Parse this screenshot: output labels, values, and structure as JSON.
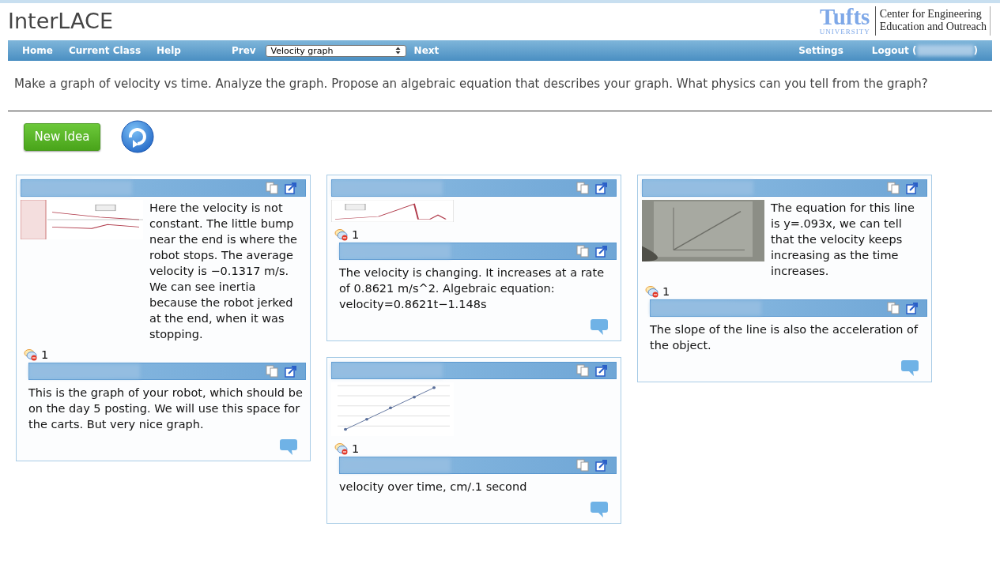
{
  "header": {
    "app_title": "InterLACE",
    "logo": {
      "wordmark": "Tufts",
      "sub": "UNIVERSITY",
      "lines": [
        "Center for Engineering",
        "Education and Outreach"
      ]
    }
  },
  "nav": {
    "left": [
      "Home",
      "Current Class",
      "Help"
    ],
    "prev": "Prev",
    "select_value": "Velocity graph",
    "next": "Next",
    "settings": "Settings",
    "logout_open": "Logout (",
    "logout_close": ")"
  },
  "prompt": "Make a graph of velocity vs time.  Analyze the graph. Propose an algebraic equation that describes your graph.  What physics can you tell from the graph?",
  "new_idea": "New Idea",
  "columns": [
    [
      {
        "image": {
          "kind": "picture"
        },
        "text": "Here the velocity is not constant. The little bump near the end is where the robot stops. The average velocity is −0.1317 m/s. We can see inertia because the robot jerked at the end, when it was stopping.",
        "reply_count": "1",
        "replies": [
          {
            "text": "This is the graph of your robot, which should be on the day 5 posting. We will use this space for the carts. But very nice graph."
          }
        ]
      }
    ],
    [
      {
        "image": {
          "kind": "picture"
        },
        "reply_count": "1",
        "replies": [
          {
            "text": "The velocity is changing. It increases at a rate of 0.8621 m/s^2. Algebraic equation: velocity=0.8621t−1.148s"
          }
        ]
      },
      {
        "image": {
          "kind": "picture"
        },
        "reply_count": "1",
        "replies": [
          {
            "text": "velocity over time, cm/.1 second"
          }
        ]
      }
    ],
    [
      {
        "image": {
          "kind": "picture"
        },
        "text": "The equation for this line is y=.093x, we can tell that the velocity keeps increasing as the time increases.",
        "reply_count": "1",
        "replies": [
          {
            "text": "The slope of the line is also the acceleration of the object."
          }
        ]
      }
    ]
  ]
}
